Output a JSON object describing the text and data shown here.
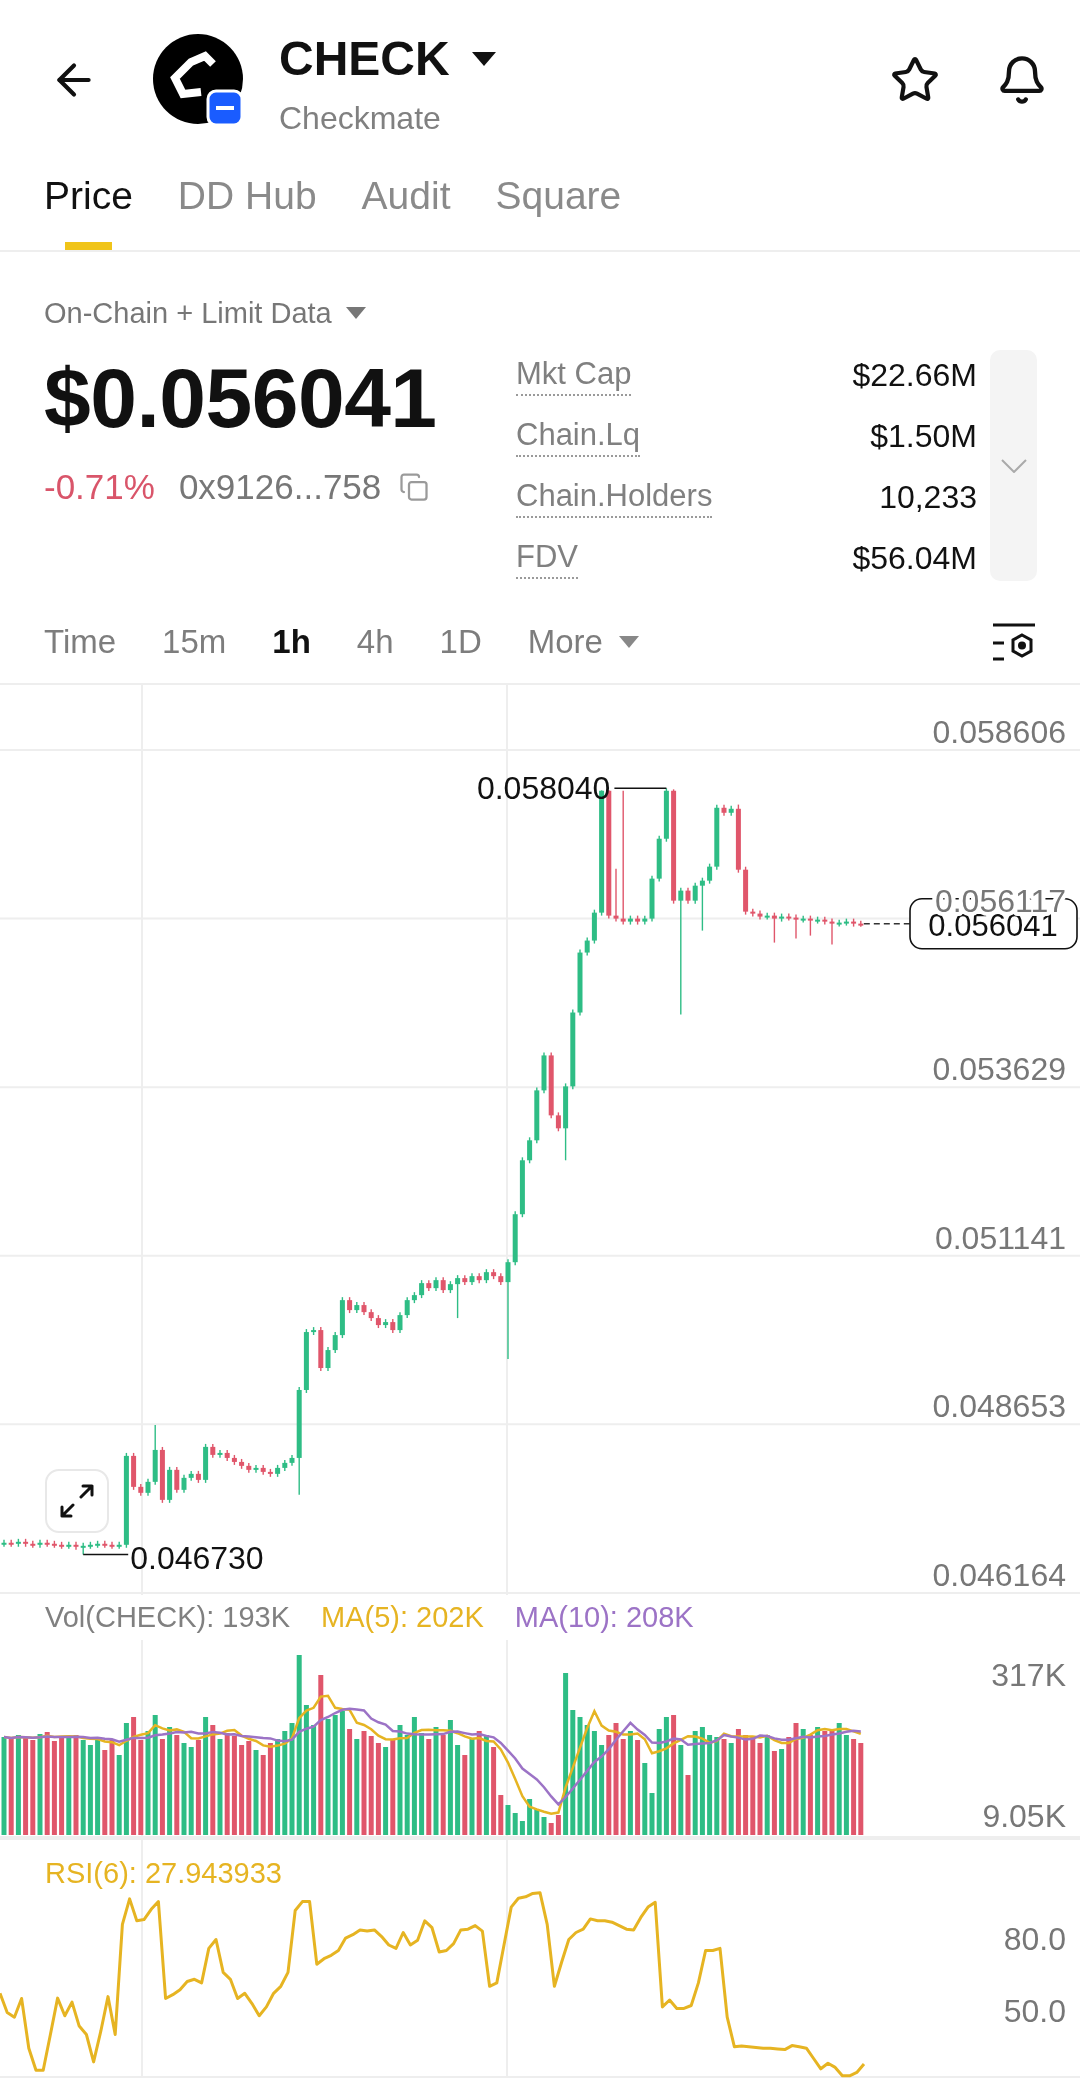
{
  "header": {
    "symbol": "CHECK",
    "name": "Checkmate"
  },
  "tabs": [
    {
      "label": "Price",
      "selected": true
    },
    {
      "label": "DD Hub",
      "selected": false
    },
    {
      "label": "Audit",
      "selected": false
    },
    {
      "label": "Square",
      "selected": false
    }
  ],
  "summary": {
    "data_source": "On-Chain + Limit Data",
    "price": "$0.056041",
    "change": {
      "text": "-0.71%",
      "negative": true
    },
    "address": "0x9126...758",
    "stats": [
      {
        "label": "Mkt Cap",
        "value": "$22.66M"
      },
      {
        "label": "Chain.Lq",
        "value": "$1.50M"
      },
      {
        "label": "Chain.Holders",
        "value": "10,233"
      },
      {
        "label": "FDV",
        "value": "$56.04M"
      }
    ],
    "stats_expanded": false
  },
  "intervals": [
    {
      "label": "Time",
      "kind": "interval",
      "selected": false
    },
    {
      "label": "15m",
      "kind": "interval",
      "selected": false
    },
    {
      "label": "1h",
      "kind": "interval",
      "selected": true
    },
    {
      "label": "4h",
      "kind": "interval",
      "selected": false
    },
    {
      "label": "1D",
      "kind": "interval",
      "selected": false
    },
    {
      "label": "More",
      "kind": "dropdown",
      "selected": false
    }
  ],
  "price_chart": {
    "chart_data": {
      "type": "candlestick",
      "grid": true,
      "ylim": [
        0.046134,
        0.059565
      ],
      "yticks": [
        0.058606,
        0.056117,
        0.053629,
        0.051141,
        0.048653,
        0.046164
      ],
      "ohlc": [
        [
          0.04689,
          0.046949,
          0.046846,
          0.046905
        ],
        [
          0.046905,
          0.046949,
          0.046846,
          0.04689
        ],
        [
          0.04689,
          0.046963,
          0.046846,
          0.046919
        ],
        [
          0.046919,
          0.046963,
          0.046846,
          0.04689
        ],
        [
          0.04689,
          0.046934,
          0.046831,
          0.046875
        ],
        [
          0.046875,
          0.046949,
          0.046831,
          0.046905
        ],
        [
          0.046905,
          0.046949,
          0.046846,
          0.04689
        ],
        [
          0.04689,
          0.046934,
          0.046831,
          0.046875
        ],
        [
          0.046875,
          0.046919,
          0.046816,
          0.04686
        ],
        [
          0.04686,
          0.046919,
          0.046816,
          0.046875
        ],
        [
          0.046875,
          0.046919,
          0.046802,
          0.046846
        ],
        [
          0.046846,
          0.046904,
          0.04673,
          0.04686
        ],
        [
          0.04686,
          0.046919,
          0.046816,
          0.046875
        ],
        [
          0.046875,
          0.046934,
          0.046831,
          0.04689
        ],
        [
          0.04689,
          0.046934,
          0.046831,
          0.046875
        ],
        [
          0.046875,
          0.046919,
          0.046816,
          0.04686
        ],
        [
          0.04686,
          0.046919,
          0.046816,
          0.046875
        ],
        [
          0.046875,
          0.048231,
          0.046831,
          0.048187
        ],
        [
          0.048187,
          0.048231,
          0.047686,
          0.04773
        ],
        [
          0.04773,
          0.047774,
          0.047598,
          0.047642
        ],
        [
          0.047642,
          0.047848,
          0.047598,
          0.047804
        ],
        [
          0.047804,
          0.048644,
          0.04776,
          0.048275
        ],
        [
          0.048275,
          0.048319,
          0.047494,
          0.047538
        ],
        [
          0.047538,
          0.048025,
          0.047494,
          0.047981
        ],
        [
          0.047981,
          0.048025,
          0.047642,
          0.047686
        ],
        [
          0.047686,
          0.047907,
          0.047642,
          0.047863
        ],
        [
          0.047863,
          0.047966,
          0.047819,
          0.047922
        ],
        [
          0.047922,
          0.047966,
          0.047789,
          0.047833
        ],
        [
          0.047833,
          0.048364,
          0.047789,
          0.04832
        ],
        [
          0.04832,
          0.048364,
          0.048158,
          0.048202
        ],
        [
          0.048202,
          0.048275,
          0.048158,
          0.048231
        ],
        [
          0.048231,
          0.048275,
          0.048113,
          0.048157
        ],
        [
          0.048157,
          0.048201,
          0.048054,
          0.048098
        ],
        [
          0.048098,
          0.048142,
          0.047996,
          0.04804
        ],
        [
          0.04804,
          0.048084,
          0.047937,
          0.047981
        ],
        [
          0.047981,
          0.048054,
          0.047937,
          0.04801
        ],
        [
          0.04801,
          0.048054,
          0.047907,
          0.047951
        ],
        [
          0.047951,
          0.047995,
          0.047878,
          0.047922
        ],
        [
          0.047922,
          0.048054,
          0.047878,
          0.04801
        ],
        [
          0.04801,
          0.048128,
          0.047966,
          0.048084
        ],
        [
          0.048084,
          0.048201,
          0.04804,
          0.048157
        ],
        [
          0.048157,
          0.049204,
          0.047612,
          0.04916
        ],
        [
          0.04916,
          0.050059,
          0.049116,
          0.050015
        ],
        [
          0.050015,
          0.050088,
          0.049971,
          0.050044
        ],
        [
          0.050044,
          0.05009,
          0.04944,
          0.049484
        ],
        [
          0.049484,
          0.049793,
          0.04944,
          0.049749
        ],
        [
          0.049749,
          0.050014,
          0.049705,
          0.04997
        ],
        [
          0.04997,
          0.05053,
          0.049926,
          0.050486
        ],
        [
          0.050486,
          0.05053,
          0.050295,
          0.050339
        ],
        [
          0.050339,
          0.050457,
          0.050295,
          0.050413
        ],
        [
          0.050413,
          0.050457,
          0.050265,
          0.050309
        ],
        [
          0.050309,
          0.050353,
          0.050177,
          0.050221
        ],
        [
          0.050221,
          0.050265,
          0.050074,
          0.050118
        ],
        [
          0.050118,
          0.050206,
          0.050074,
          0.050162
        ],
        [
          0.050162,
          0.050206,
          0.05,
          0.050044
        ],
        [
          0.050044,
          0.050309,
          0.05,
          0.050265
        ],
        [
          0.050265,
          0.05053,
          0.050221,
          0.050486
        ],
        [
          0.050486,
          0.050604,
          0.050442,
          0.05056
        ],
        [
          0.05056,
          0.050781,
          0.050516,
          0.050737
        ],
        [
          0.050737,
          0.050781,
          0.050619,
          0.050663
        ],
        [
          0.050663,
          0.050825,
          0.050619,
          0.050781
        ],
        [
          0.050781,
          0.050825,
          0.05059,
          0.050634
        ],
        [
          0.050634,
          0.050766,
          0.05059,
          0.050722
        ],
        [
          0.050722,
          0.050855,
          0.050221,
          0.050811
        ],
        [
          0.050811,
          0.050855,
          0.050708,
          0.050752
        ],
        [
          0.050752,
          0.050884,
          0.050708,
          0.05084
        ],
        [
          0.05084,
          0.050884,
          0.050737,
          0.050781
        ],
        [
          0.050781,
          0.050943,
          0.050737,
          0.050899
        ],
        [
          0.050899,
          0.050943,
          0.050796,
          0.05084
        ],
        [
          0.05084,
          0.050884,
          0.050708,
          0.050752
        ],
        [
          0.050752,
          0.05109,
          0.049617,
          0.051046
        ],
        [
          0.051046,
          0.051798,
          0.051002,
          0.051754
        ],
        [
          0.051754,
          0.052594,
          0.05171,
          0.05255
        ],
        [
          0.05255,
          0.052889,
          0.052506,
          0.052845
        ],
        [
          0.052845,
          0.053626,
          0.052801,
          0.053582
        ],
        [
          0.053582,
          0.054142,
          0.053538,
          0.054098
        ],
        [
          0.054098,
          0.054142,
          0.053169,
          0.053213
        ],
        [
          0.053213,
          0.053257,
          0.052978,
          0.053022
        ],
        [
          0.053022,
          0.053685,
          0.05255,
          0.053641
        ],
        [
          0.053641,
          0.054775,
          0.053597,
          0.054731
        ],
        [
          0.054731,
          0.05566,
          0.054687,
          0.055616
        ],
        [
          0.055616,
          0.055837,
          0.055572,
          0.055793
        ],
        [
          0.055793,
          0.056249,
          0.055749,
          0.056205
        ],
        [
          0.056205,
          0.05801,
          0.056161,
          0.058004
        ],
        [
          0.058004,
          0.058012,
          0.056117,
          0.056161
        ],
        [
          0.056161,
          0.056854,
          0.056073,
          0.056117
        ],
        [
          0.056117,
          0.058004,
          0.056029,
          0.056073
        ],
        [
          0.056073,
          0.056161,
          0.056029,
          0.056117
        ],
        [
          0.056117,
          0.056161,
          0.056029,
          0.056073
        ],
        [
          0.056073,
          0.056161,
          0.056029,
          0.056117
        ],
        [
          0.056117,
          0.056751,
          0.056073,
          0.056707
        ],
        [
          0.056707,
          0.05734,
          0.056663,
          0.057296
        ],
        [
          0.057296,
          0.05804,
          0.057252,
          0.058004
        ],
        [
          0.058004,
          0.058025,
          0.056338,
          0.056382
        ],
        [
          0.056382,
          0.056574,
          0.054702,
          0.05653
        ],
        [
          0.05653,
          0.056574,
          0.056338,
          0.056382
        ],
        [
          0.056382,
          0.056647,
          0.056338,
          0.056603
        ],
        [
          0.056603,
          0.056721,
          0.05594,
          0.056677
        ],
        [
          0.056677,
          0.056928,
          0.056633,
          0.056884
        ],
        [
          0.056884,
          0.057797,
          0.05684,
          0.057753
        ],
        [
          0.057753,
          0.057797,
          0.057635,
          0.057679
        ],
        [
          0.057679,
          0.057782,
          0.057635,
          0.057738
        ],
        [
          0.057738,
          0.0578,
          0.056795,
          0.056839
        ],
        [
          0.056839,
          0.056883,
          0.056176,
          0.05622
        ],
        [
          0.05622,
          0.056264,
          0.056147,
          0.056191
        ],
        [
          0.056191,
          0.056235,
          0.056103,
          0.056147
        ],
        [
          0.056147,
          0.056205,
          0.056103,
          0.056161
        ],
        [
          0.056161,
          0.056205,
          0.055763,
          0.056117
        ],
        [
          0.056117,
          0.056191,
          0.056073,
          0.056147
        ],
        [
          0.056147,
          0.056191,
          0.056088,
          0.056132
        ],
        [
          0.056132,
          0.056176,
          0.055822,
          0.056102
        ],
        [
          0.056102,
          0.056161,
          0.056058,
          0.056117
        ],
        [
          0.056117,
          0.056161,
          0.055866,
          0.056088
        ],
        [
          0.056088,
          0.056146,
          0.056044,
          0.056102
        ],
        [
          0.056102,
          0.056146,
          0.056029,
          0.056073
        ],
        [
          0.056073,
          0.056117,
          0.055734,
          0.056043
        ],
        [
          0.056043,
          0.056102,
          0.055999,
          0.056058
        ],
        [
          0.056058,
          0.056117,
          0.056014,
          0.056073
        ],
        [
          0.056073,
          0.056117,
          0.055999,
          0.056043
        ],
        [
          0.056043,
          0.056087,
          0.055997,
          0.056041
        ]
      ]
    },
    "high_label": "0.058040",
    "low_label": "0.046730",
    "last_price": "0.056041"
  },
  "volume_chart": {
    "legend": [
      {
        "text": "Vol(CHECK): 193K",
        "color": "#808080"
      },
      {
        "text": "MA(5): 202K",
        "color": "#e6b422"
      },
      {
        "text": "MA(10): 208K",
        "color": "#9c73c6"
      }
    ],
    "axis_labels": [
      "317K",
      "9.05K"
    ]
  },
  "rsi_chart": {
    "chart_data": {
      "type": "line",
      "title": "RSI(6): 27.943933",
      "grid": true,
      "categories": [
        null,
        null,
        null,
        null,
        null,
        null,
        null,
        null,
        null,
        null,
        null,
        null,
        null,
        null,
        null,
        null,
        null,
        null,
        null,
        null,
        null,
        null,
        null,
        null,
        null,
        null,
        null,
        null,
        null,
        null,
        null,
        null,
        null,
        null,
        null,
        null,
        null,
        null,
        null,
        null,
        null,
        null,
        null,
        null,
        null,
        null,
        null,
        null,
        null,
        null,
        null,
        null,
        null,
        null,
        null,
        null,
        null,
        null,
        null,
        null,
        null,
        null,
        null,
        null,
        null,
        null,
        null,
        null,
        null,
        null,
        null,
        null,
        null,
        null,
        null,
        null,
        null,
        null,
        null,
        null,
        null,
        null,
        null,
        null,
        null,
        null,
        null,
        null,
        null,
        null,
        null,
        null,
        null,
        null,
        null,
        null,
        null,
        null,
        null,
        null,
        null,
        null,
        null,
        null,
        null,
        null,
        null,
        null,
        null,
        null,
        null,
        null,
        null,
        null,
        null,
        null,
        null,
        null,
        null,
        null,
        null
      ],
      "series": [
        {
          "color": "#e6b422",
          "values": [
            57.4,
            49.4,
            47.4,
            55.2,
            34.5,
            25.3,
            25.3,
            40.2,
            55.4,
            48.0,
            53.7,
            43.7,
            40.2,
            28.8,
            41.6,
            56.0,
            40.2,
            86.1,
            96.7,
            87.6,
            88.1,
            92.4,
            95.6,
            55.2,
            56.8,
            58.9,
            62.3,
            63.2,
            61.7,
            76.1,
            79.8,
            66.1,
            63.2,
            55.2,
            57.4,
            53.1,
            48.0,
            51.7,
            57.4,
            60.3,
            66.1,
            91.9,
            95.6,
            95.6,
            69.5,
            71.8,
            73.2,
            75.2,
            80.4,
            81.8,
            83.8,
            83.3,
            83.8,
            81.0,
            77.5,
            76.1,
            82.7,
            77.5,
            79.5,
            87.6,
            84.7,
            74.6,
            75.2,
            78.1,
            83.8,
            84.1,
            85.6,
            83.3,
            60.3,
            61.7,
            77.5,
            93.3,
            97.0,
            97.6,
            99.0,
            99.3,
            86.1,
            60.3,
            70.3,
            79.8,
            82.7,
            84.1,
            88.4,
            87.6,
            87.6,
            87.0,
            85.6,
            84.1,
            83.8,
            89.0,
            93.3,
            95.3,
            51.7,
            54.6,
            51.1,
            51.1,
            52.3,
            61.7,
            75.2,
            75.2,
            76.1,
            47.4,
            35.1,
            35.4,
            35.1,
            34.8,
            34.5,
            34.5,
            34.2,
            33.9,
            35.6,
            35.1,
            34.5,
            30.2,
            25.9,
            28.2,
            26.5,
            23.0,
            23.0,
            24.4,
            27.9
          ]
        }
      ],
      "ylim": [
        22.5,
        122.1
      ],
      "yticks": [
        {
          "value": 80,
          "label": "80.0"
        },
        {
          "value": 50,
          "label": "50.0"
        }
      ]
    }
  }
}
